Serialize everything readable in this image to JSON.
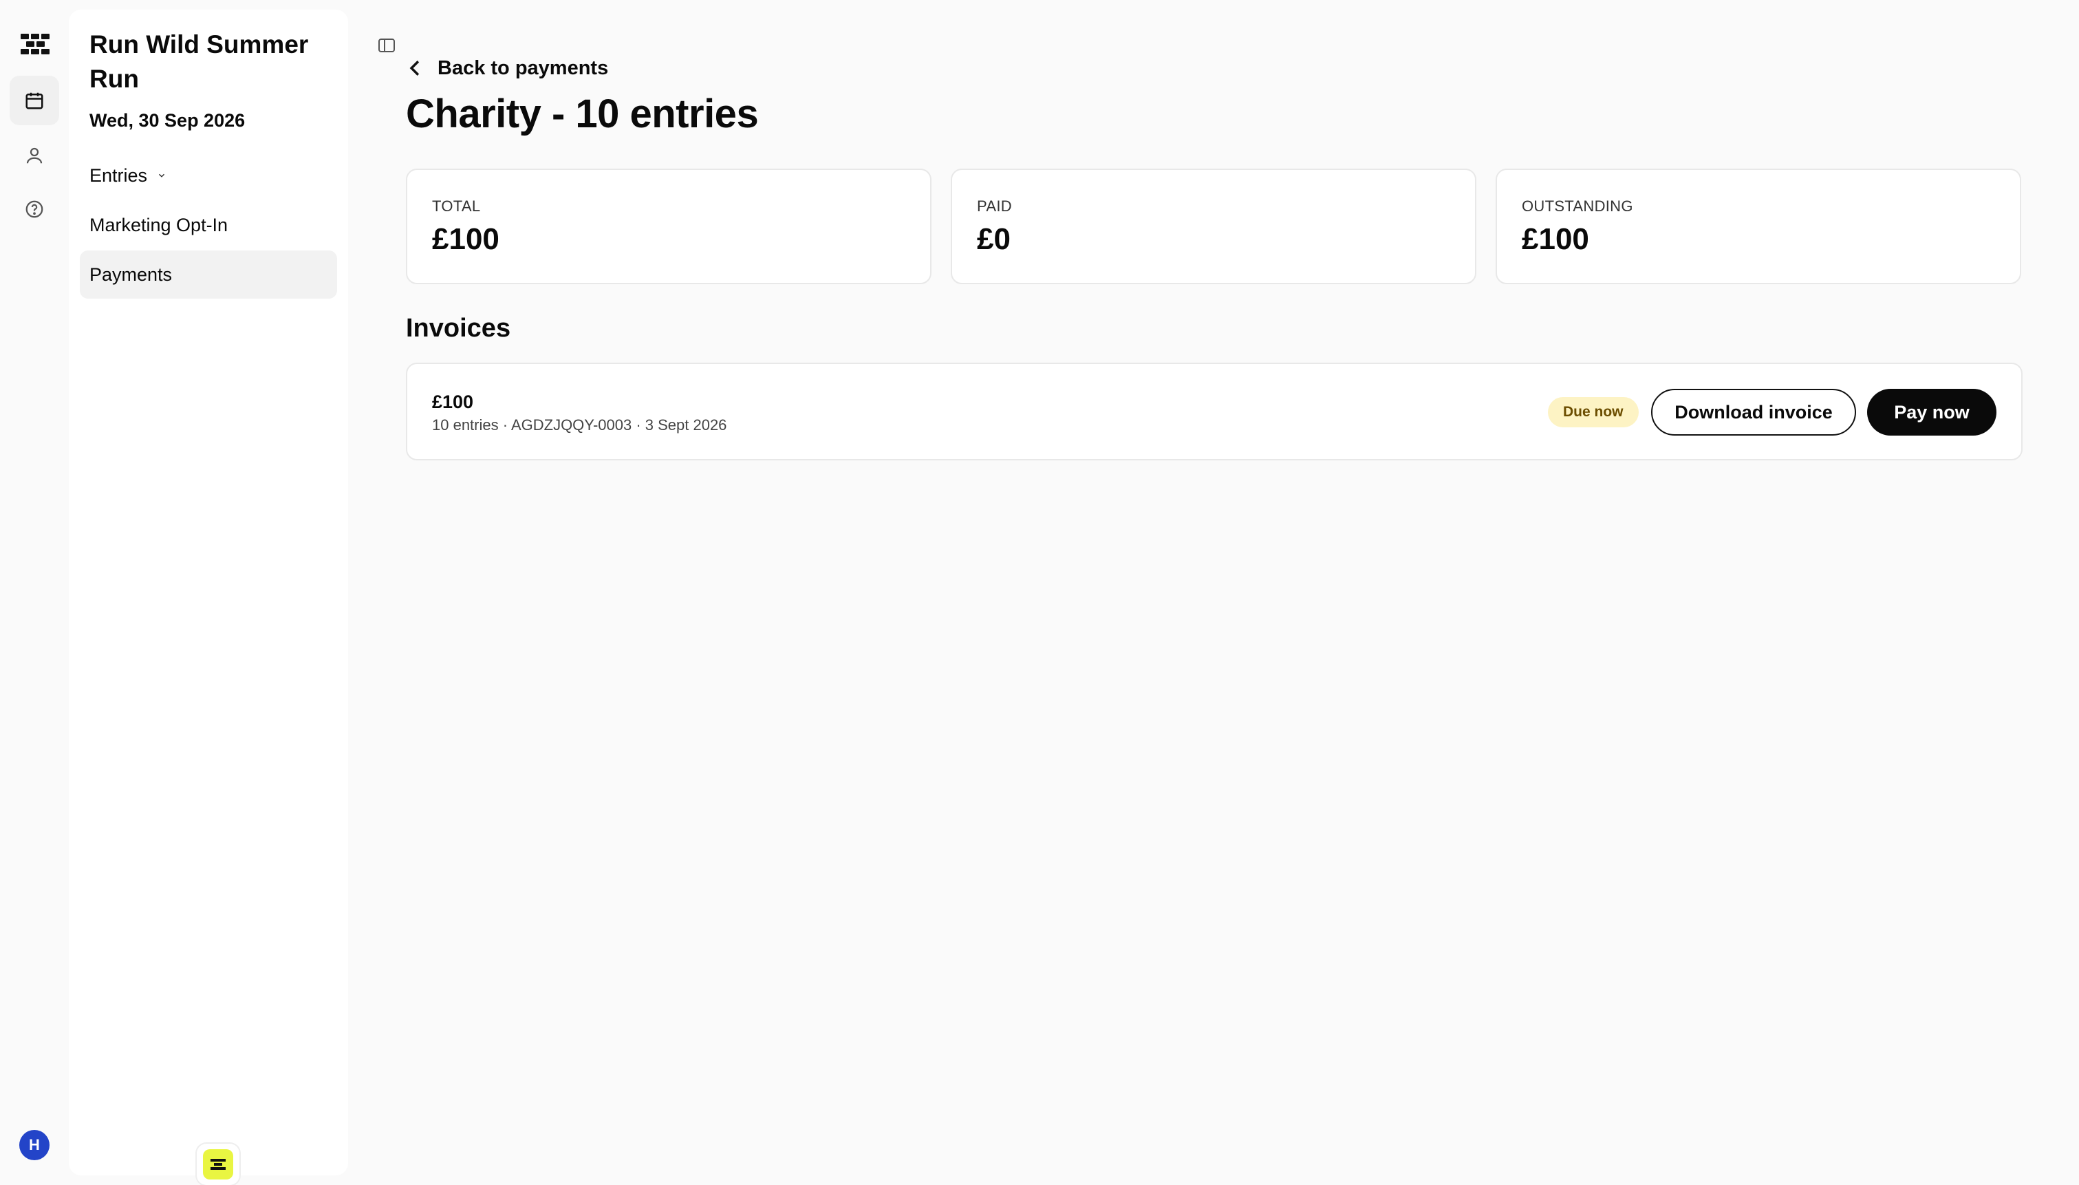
{
  "rail": {
    "items": [
      {
        "icon": "calendar-icon",
        "active": true
      },
      {
        "icon": "user-icon",
        "active": false
      },
      {
        "icon": "help-icon",
        "active": false
      }
    ],
    "avatar_initial": "H"
  },
  "sidebar": {
    "event_title": "Run Wild Summer Run",
    "event_date": "Wed, 30 Sep 2026",
    "items": [
      {
        "label": "Entries",
        "has_dropdown": true
      },
      {
        "label": "Marketing Opt-In"
      },
      {
        "label": "Payments",
        "active": true
      }
    ]
  },
  "header": {
    "back_label": "Back to payments",
    "title": "Charity - 10 entries"
  },
  "stats": [
    {
      "label": "TOTAL",
      "value": "£100"
    },
    {
      "label": "PAID",
      "value": "£0"
    },
    {
      "label": "OUTSTANDING",
      "value": "£100"
    }
  ],
  "invoices": {
    "title": "Invoices",
    "items": [
      {
        "amount": "£100",
        "meta": "10 entries · AGDZJQQY-0003 · 3 Sept 2026",
        "status": "Due now",
        "download_label": "Download invoice",
        "pay_label": "Pay now"
      }
    ]
  },
  "colors": {
    "accent": "#0a0a0a",
    "avatar": "#2344c8",
    "badge_yellow": "#e9f542",
    "due_bg": "#fdf3c4"
  }
}
